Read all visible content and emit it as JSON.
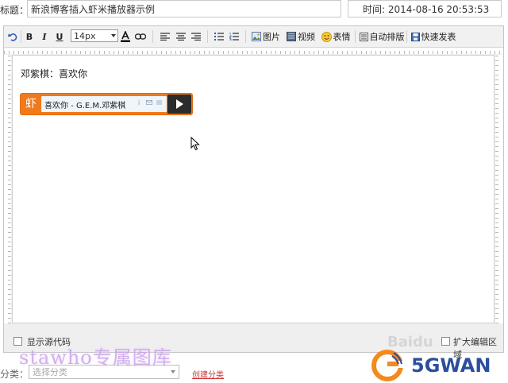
{
  "title_row": {
    "label": "标题：",
    "title_value": "新浪博客插入虾米播放器示例",
    "time_text": "时间: 2014-08-16 20:53:53"
  },
  "toolbar": {
    "font_size": "14px",
    "image_label": "图片",
    "video_label": "视频",
    "emoji_label": "表情",
    "autoformat_label": "自动排版",
    "publish_label": "快速发表"
  },
  "content": {
    "text_line": "邓紫棋：喜欢你",
    "player": {
      "logo": "虾",
      "track": "喜欢你 - G.E.M.邓紫棋",
      "info_icon": "i"
    }
  },
  "editor_footer": {
    "show_source_label": "显示源代码",
    "expand_label": "扩大编辑区域"
  },
  "category": {
    "label": "分类：",
    "select_placeholder": "选择分类",
    "create_link": "创建分类"
  },
  "watermarks": {
    "text1": "stawho专属图库",
    "baidu": "Baidu",
    "brand": "5GWAN"
  },
  "colors": {
    "player_orange": "#f07a1a",
    "brand_blue": "#2b4f9c",
    "brand_orange": "#f28a1e"
  }
}
